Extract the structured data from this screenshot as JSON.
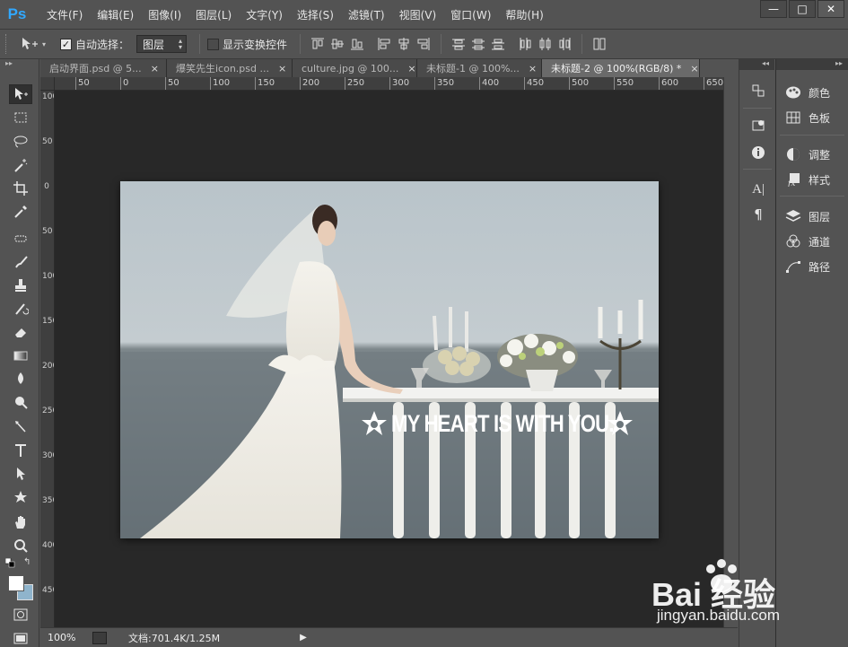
{
  "app": {
    "logo": "Ps",
    "menu": [
      "文件(F)",
      "编辑(E)",
      "图像(I)",
      "图层(L)",
      "文字(Y)",
      "选择(S)",
      "滤镜(T)",
      "视图(V)",
      "窗口(W)",
      "帮助(H)"
    ],
    "window_controls": [
      "—",
      "□",
      "✕"
    ]
  },
  "options_bar": {
    "auto_select_label": "自动选择：",
    "auto_select_checked": true,
    "auto_select_target": "图层",
    "show_transform_label": "显示变换控件",
    "show_transform_checked": false
  },
  "tabs": [
    {
      "label": "启动界面.psd @ 5...",
      "active": false
    },
    {
      "label": "爆笑先生icon.psd ...",
      "active": false
    },
    {
      "label": "culture.jpg @ 100...",
      "active": false
    },
    {
      "label": "未标题-1 @ 100%...",
      "active": false
    },
    {
      "label": "未标题-2 @ 100%(RGB/8) *",
      "active": true
    }
  ],
  "ruler": {
    "h_labels": [
      "50",
      "0",
      "50",
      "100",
      "150",
      "200",
      "250",
      "300",
      "350",
      "400",
      "450",
      "500",
      "550",
      "600",
      "650"
    ],
    "v_labels": [
      "100",
      "50",
      "0",
      "50",
      "100",
      "150",
      "200",
      "250",
      "300",
      "350",
      "400",
      "450",
      "500"
    ]
  },
  "canvas": {
    "overlay_text": "MY HEART IS WITH YOU."
  },
  "status": {
    "zoom": "100%",
    "doc_info": "文档:701.4K/1.25M"
  },
  "panels": [
    {
      "label": "颜色",
      "icon": "palette-icon"
    },
    {
      "label": "色板",
      "icon": "swatches-icon"
    },
    {
      "label": "调整",
      "icon": "adjustments-icon"
    },
    {
      "label": "样式",
      "icon": "styles-icon"
    },
    {
      "label": "图层",
      "icon": "layers-icon"
    },
    {
      "label": "通道",
      "icon": "channels-icon"
    },
    {
      "label": "路径",
      "icon": "paths-icon"
    }
  ],
  "watermark": {
    "brand": "Bai 经验",
    "url": "jingyan.baidu.com"
  },
  "colors": {
    "ui_bg": "#535353",
    "canvas_bg": "#282828",
    "ps_blue": "#31a8ff",
    "foreground": "#ffffff",
    "background": "#8fb4cc"
  }
}
